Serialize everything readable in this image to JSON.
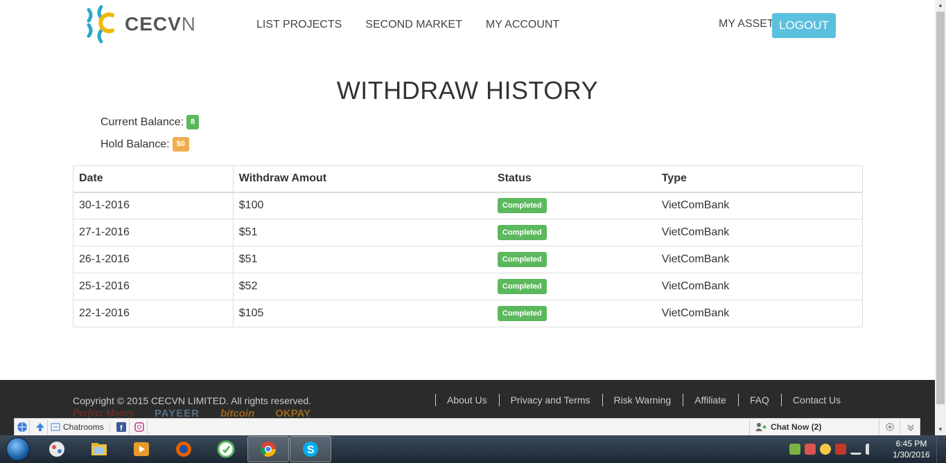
{
  "header": {
    "logo_text_bold": "CECV",
    "logo_text_thin": "N",
    "nav": [
      "LIST PROJECTS",
      "SECOND MARKET",
      "MY ACCOUNT"
    ],
    "my_asset": "MY ASSET",
    "logout": "LOGOUT"
  },
  "main": {
    "title": "WITHDRAW HISTORY",
    "current_balance_label": "Current Balance:",
    "current_balance_value": "8",
    "hold_balance_label": "Hold Balance:",
    "hold_balance_value": "$0",
    "table": {
      "headers": [
        "Date",
        "Withdraw Amout",
        "Status",
        "Type"
      ],
      "rows": [
        {
          "date": "30-1-2016",
          "amount": "$100",
          "status": "Completed",
          "type": "VietComBank"
        },
        {
          "date": "27-1-2016",
          "amount": "$51",
          "status": "Completed",
          "type": "VietComBank"
        },
        {
          "date": "26-1-2016",
          "amount": "$51",
          "status": "Completed",
          "type": "VietComBank"
        },
        {
          "date": "25-1-2016",
          "amount": "$52",
          "status": "Completed",
          "type": "VietComBank"
        },
        {
          "date": "22-1-2016",
          "amount": "$105",
          "status": "Completed",
          "type": "VietComBank"
        }
      ]
    }
  },
  "footer": {
    "copyright": "Copyright © 2015 CECVN LIMITED. All rights reserved.",
    "links": [
      "About Us",
      "Privacy and Terms",
      "Risk Warning",
      "Affiliate",
      "FAQ",
      "Contact Us"
    ],
    "payment_logos": [
      "Perfect Money",
      "PAYEER",
      "bitcoin",
      "OKPAY"
    ]
  },
  "toolbar": {
    "chatrooms": "Chatrooms",
    "chat_now": "Chat Now (2)"
  },
  "taskbar": {
    "time": "6:45 PM",
    "date": "1/30/2016"
  },
  "colors": {
    "logout_bg": "#5bc0de",
    "success": "#5cb85c",
    "warning": "#f0ad4e",
    "footer_bg": "#2b2b2b"
  }
}
